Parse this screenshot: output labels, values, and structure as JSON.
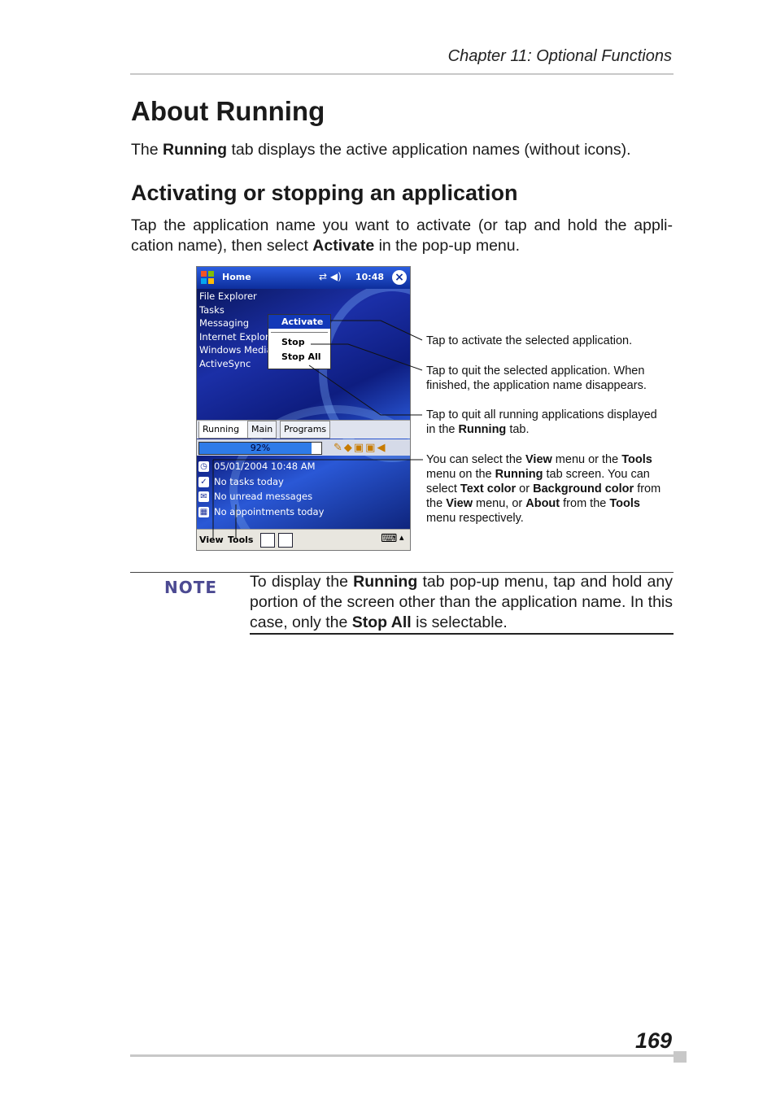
{
  "header": {
    "chapter": "Chapter 11: Optional Functions"
  },
  "page_title": "About Running",
  "intro": {
    "pre": "The ",
    "bold": "Running",
    "post": " tab displays the active application names (without icons)."
  },
  "section_title": "Activating or stopping an application",
  "body": {
    "pre": "Tap the application name you want to activate (or tap and hold the appli-cation name), then select ",
    "bold": "Activate",
    "post": " in the pop-up menu."
  },
  "screen": {
    "title": "Home",
    "time": "10:48",
    "apps": [
      "File Explorer",
      "Tasks",
      "Messaging",
      "Internet Explorer",
      "Windows Media",
      "ActiveSync"
    ],
    "popup": {
      "activate": "Activate",
      "stop": "Stop",
      "stop_all": "Stop All"
    },
    "tabs": [
      "Running",
      "Main",
      "Programs"
    ],
    "battery_text": "92%",
    "battery_level": 0.92,
    "today": [
      "05/01/2004 10:48 AM",
      "No tasks today",
      "No unread messages",
      "No appointments today"
    ],
    "menu": {
      "view": "View",
      "tools": "Tools"
    }
  },
  "callouts": {
    "activate": "Tap to activate the selected application.",
    "stop": "Tap to quit the selected application. When finished, the application name disappears.",
    "stop_all": {
      "l1": "Tap to quit all running applications displayed",
      "l2_pre": "in the ",
      "l2_bold": "Running",
      "l2_post": " tab."
    },
    "menus": {
      "t1": "You can select the ",
      "b1": "View",
      "t2": " menu or the ",
      "b2": "Tools",
      "t3": " menu on the ",
      "b3": "Running",
      "t4": " tab screen. You can select ",
      "b4": "Text color",
      "t5": " or ",
      "b5": "Background color",
      "t6": " from the ",
      "b6": "View",
      "t7": " menu, or ",
      "b7": "About",
      "t8": " from the ",
      "b8": "Tools",
      "t9": " menu respectively."
    }
  },
  "note": {
    "label": "NOTE",
    "t1": "To display the ",
    "b1": "Running",
    "t2": " tab pop-up menu, tap and hold any portion of the screen other than the application name. In this case, only the ",
    "b2": "Stop All",
    "t3": " is selectable."
  },
  "page_number": "169"
}
